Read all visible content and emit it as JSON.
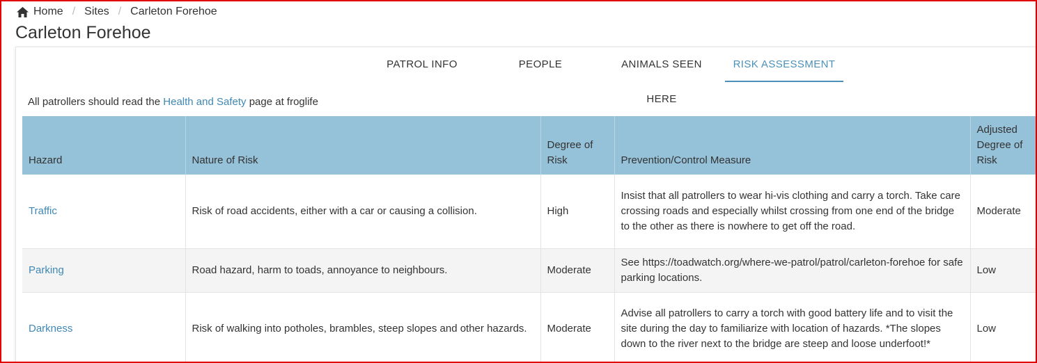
{
  "breadcrumb": {
    "home": "Home",
    "sites": "Sites",
    "current": "Carleton Forehoe"
  },
  "page_title": "Carleton Forehoe",
  "tabs": [
    {
      "label": "PATROL INFO",
      "active": false
    },
    {
      "label": "PEOPLE",
      "active": false
    },
    {
      "label": "ANIMALS SEEN HERE",
      "active": false
    },
    {
      "label": "RISK ASSESSMENT",
      "active": true
    }
  ],
  "notice": {
    "before": "All patrollers should read the ",
    "link": "Health and Safety",
    "after": " page at froglife"
  },
  "table": {
    "headers": [
      "Hazard",
      "Nature of Risk",
      "Degree of Risk",
      "Prevention/Control Measure",
      "Adjusted Degree of Risk"
    ],
    "rows": [
      {
        "hazard": "Traffic",
        "nature": "Risk of road accidents, either with a car or causing a collision.",
        "degree": "High",
        "measure": "Insist that all patrollers to wear hi-vis clothing and carry a torch. Take care crossing roads and especially whilst crossing from one end of the bridge to the other as there is nowhere to get off the road.",
        "adjusted": "Moderate"
      },
      {
        "hazard": "Parking",
        "nature": "Road hazard, harm to toads, annoyance to neighbours.",
        "degree": "Moderate",
        "measure": "See https://toadwatch.org/where-we-patrol/patrol/carleton-forehoe for safe parking locations.",
        "adjusted": "Low"
      },
      {
        "hazard": "Darkness",
        "nature": "Risk of walking into potholes, brambles, steep slopes and other hazards.",
        "degree": "Moderate",
        "measure": "Advise all patrollers to carry a torch with good battery life and to visit the site during the day to familiarize with location of hazards. *The slopes down to the river next to the bridge are steep and loose underfoot!*",
        "adjusted": "Low"
      }
    ]
  },
  "colors": {
    "accent": "#4a90b8",
    "link": "#3f88b5",
    "header_bg": "#95c1d9",
    "frame": "#e00000"
  }
}
